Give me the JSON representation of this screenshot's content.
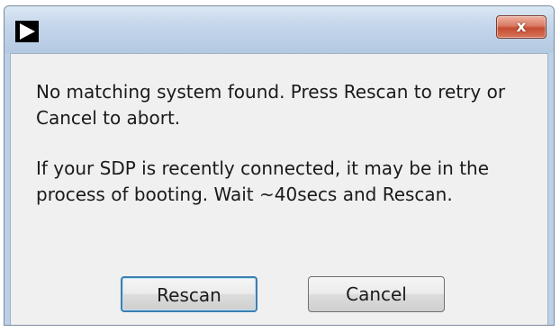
{
  "window": {
    "app_icon": "play-arrow-icon",
    "close_icon": "close-icon",
    "close_label": "x"
  },
  "dialog": {
    "message_line_1": "No matching system found. Press Rescan to retry or Cancel to abort.",
    "message_line_2": "If your SDP is recently connected, it may be in the process of booting. Wait ~40secs and Rescan."
  },
  "buttons": {
    "rescan_label": "Rescan",
    "cancel_label": "Cancel"
  },
  "colors": {
    "titlebar": "#c3d5ea",
    "close_button": "#c44c32",
    "client_background": "#f0f0f0",
    "default_button_border": "#3c7fb1"
  }
}
